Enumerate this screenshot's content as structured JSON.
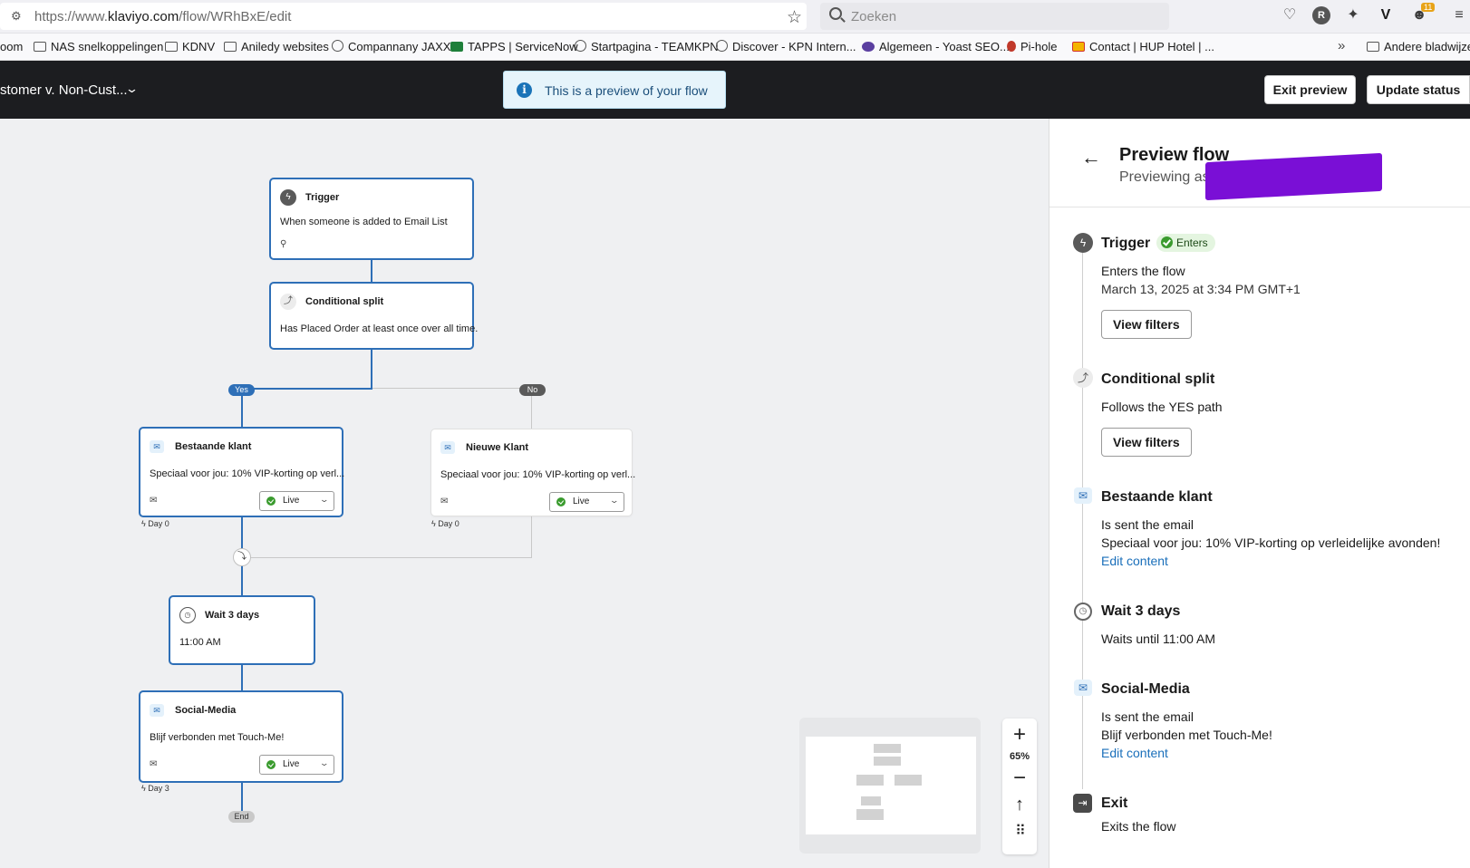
{
  "browser": {
    "url_prefix": "https://www.",
    "url_domain": "klaviyo.com",
    "url_path": "/flow/WRhBxE/edit",
    "search_placeholder": "Zoeken",
    "profile_initial": "R",
    "extension_badge": "11"
  },
  "bookmarks": [
    {
      "label": "oom",
      "icon": "none"
    },
    {
      "label": "NAS snelkoppelingen",
      "icon": "folder-icon"
    },
    {
      "label": "KDNV",
      "icon": "folder-icon"
    },
    {
      "label": "Aniledy websites",
      "icon": "folder-icon"
    },
    {
      "label": "Compannany JAXX",
      "icon": "globe-icon"
    },
    {
      "label": "TAPPS | ServiceNow",
      "icon": "servicenow-icon"
    },
    {
      "label": "Startpagina - TEAMKPN",
      "icon": "globe-icon"
    },
    {
      "label": "Discover - KPN Intern...",
      "icon": "discover-icon"
    },
    {
      "label": "Algemeen - Yoast SEO...",
      "icon": "yoast-icon"
    },
    {
      "label": "Pi-hole",
      "icon": "pihole-icon"
    },
    {
      "label": "Contact | HUP Hotel | ...",
      "icon": "hup-icon"
    },
    {
      "label": "Andere bladwijzers",
      "icon": "folder-icon"
    }
  ],
  "header": {
    "flow_name": "stomer v. Non-Cust...",
    "preview_banner": "This is a preview of your flow",
    "exit_preview": "Exit preview",
    "update_status": "Update status"
  },
  "canvas": {
    "trigger": {
      "title": "Trigger",
      "text": "When someone is added to Email List"
    },
    "split": {
      "title": "Conditional split",
      "text": "Has Placed Order at least once over all time."
    },
    "yes_label": "Yes",
    "no_label": "No",
    "email_existing": {
      "title": "Bestaande klant",
      "text": "Speciaal voor jou: 10% VIP-korting op verl...",
      "status": "Live",
      "day": "Day 0"
    },
    "email_new": {
      "title": "Nieuwe Klant",
      "text": "Speciaal voor jou: 10% VIP-korting op verl...",
      "status": "Live",
      "day": "Day 0"
    },
    "wait": {
      "title": "Wait 3 days",
      "text": "11:00 AM"
    },
    "email_social": {
      "title": "Social-Media",
      "text": "Blijf verbonden met Touch-Me!",
      "status": "Live",
      "day": "Day 3"
    },
    "end_label": "End"
  },
  "zoom": {
    "level": "65%"
  },
  "panel": {
    "title": "Preview flow",
    "subtitle": "Previewing as",
    "steps": {
      "trigger": {
        "title": "Trigger",
        "badge": "Enters",
        "line1": "Enters the flow",
        "line2": "March 13, 2025 at 3:34 PM GMT+1",
        "button": "View filters"
      },
      "split": {
        "title": "Conditional split",
        "line1": "Follows the YES path",
        "button": "View filters"
      },
      "email1": {
        "title": "Bestaande klant",
        "line1": "Is sent the email",
        "line2": "Speciaal voor jou: 10% VIP-korting op verleidelijke avonden!",
        "link": "Edit content"
      },
      "wait": {
        "title": "Wait 3 days",
        "line1": "Waits until 11:00 AM"
      },
      "email2": {
        "title": "Social-Media",
        "line1": "Is sent the email",
        "line2": "Blijf verbonden met Touch-Me!",
        "link": "Edit content"
      },
      "exit": {
        "title": "Exit",
        "line1": "Exits the flow"
      }
    }
  },
  "colors": {
    "accent": "#2e6fb7",
    "header_bg": "#1c1d20",
    "canvas_bg": "#eff0f2",
    "live_green": "#3a9b2e",
    "redaction": "#7a0fd6"
  }
}
